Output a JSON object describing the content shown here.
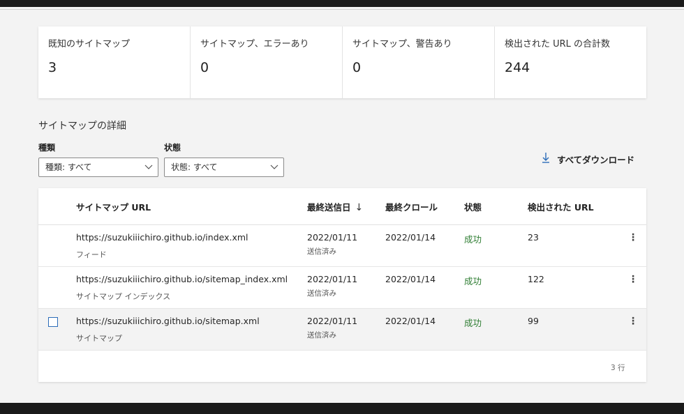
{
  "summary": [
    {
      "label": "既知のサイトマップ",
      "value": "3"
    },
    {
      "label": "サイトマップ、エラーあり",
      "value": "0"
    },
    {
      "label": "サイトマップ、警告あり",
      "value": "0"
    },
    {
      "label": "検出された URL の合計数",
      "value": "244"
    }
  ],
  "section_title": "サイトマップの詳細",
  "filters": {
    "type_label": "種類",
    "type_value": "種類: すべて",
    "status_label": "状態",
    "status_value": "状態: すべて"
  },
  "download_label": "すべてダウンロード",
  "table": {
    "headers": {
      "url": "サイトマップ URL",
      "submitted": "最終送信日",
      "crawled": "最終クロール",
      "status": "状態",
      "urls": "検出された URL"
    },
    "rows": [
      {
        "url": "https://suzukiiichiro.github.io/index.xml",
        "kind": "フィード",
        "submitted": "2022/01/11",
        "submitted_note": "送信済み",
        "crawled": "2022/01/14",
        "status": "成功",
        "urls": "23"
      },
      {
        "url": "https://suzukiiichiro.github.io/sitemap_index.xml",
        "kind": "サイトマップ インデックス",
        "submitted": "2022/01/11",
        "submitted_note": "送信済み",
        "crawled": "2022/01/14",
        "status": "成功",
        "urls": "122"
      },
      {
        "url": "https://suzukiiichiro.github.io/sitemap.xml",
        "kind": "サイトマップ",
        "submitted": "2022/01/11",
        "submitted_note": "送信済み",
        "crawled": "2022/01/14",
        "status": "成功",
        "urls": "99"
      }
    ],
    "row_count": "3 行"
  },
  "icons": {
    "sort": "arrow-down-icon",
    "download": "download-icon",
    "more": "more-vertical-icon",
    "chevron": "chevron-down-icon"
  },
  "colors": {
    "accent": "#2b6cb8",
    "success": "#2e7d32"
  }
}
